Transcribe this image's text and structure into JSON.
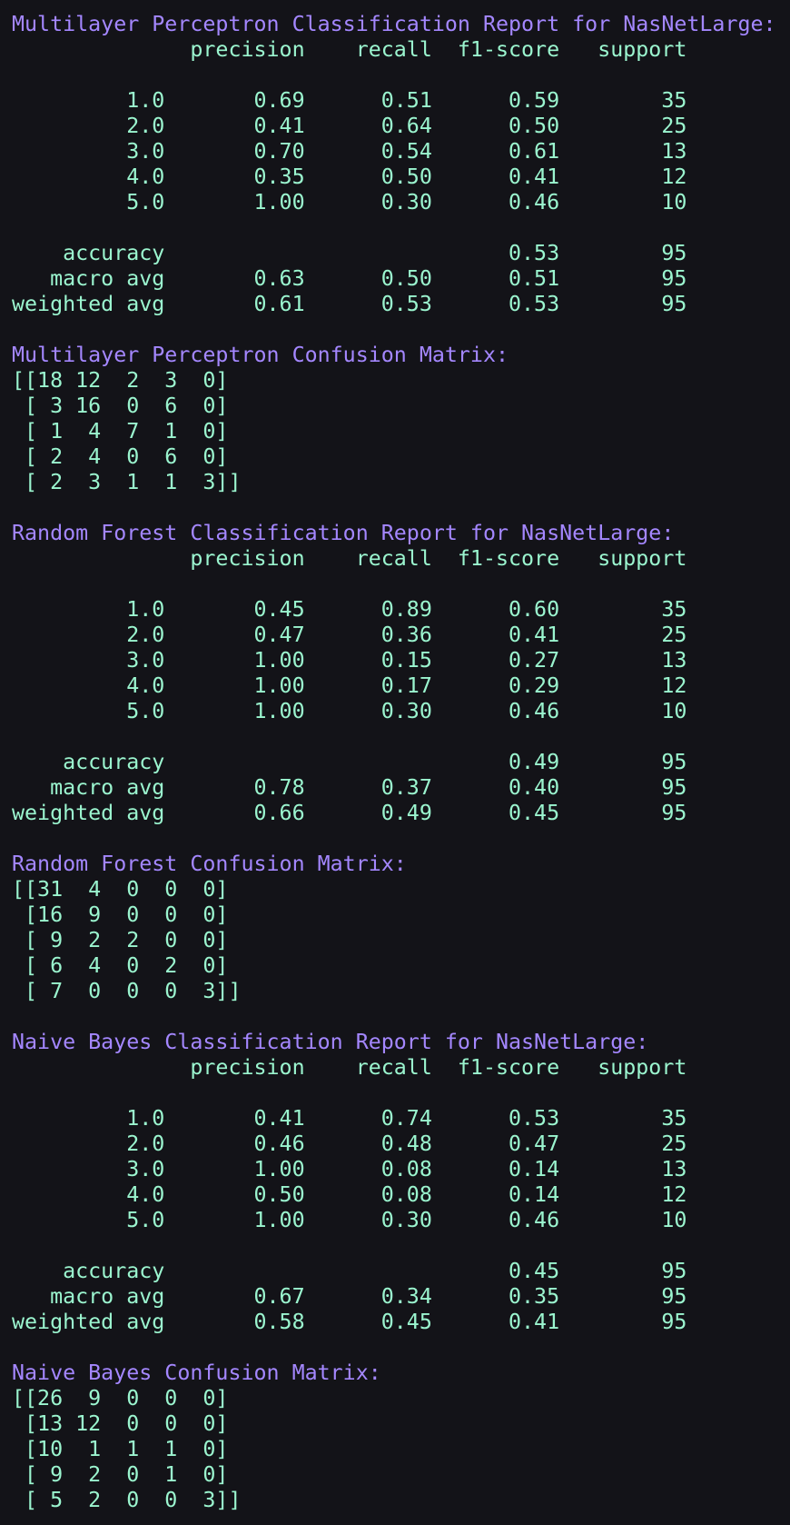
{
  "colors": {
    "background": "#131318",
    "heading": "#a487ff",
    "output": "#9bf5cf"
  },
  "lines": [
    {
      "t": "heading",
      "s": "Multilayer Perceptron Classification Report for NasNetLarge:"
    },
    {
      "t": "text",
      "s": "              precision    recall  f1-score   support"
    },
    {
      "t": "text",
      "s": ""
    },
    {
      "t": "text",
      "s": "         1.0       0.69      0.51      0.59        35"
    },
    {
      "t": "text",
      "s": "         2.0       0.41      0.64      0.50        25"
    },
    {
      "t": "text",
      "s": "         3.0       0.70      0.54      0.61        13"
    },
    {
      "t": "text",
      "s": "         4.0       0.35      0.50      0.41        12"
    },
    {
      "t": "text",
      "s": "         5.0       1.00      0.30      0.46        10"
    },
    {
      "t": "text",
      "s": ""
    },
    {
      "t": "text",
      "s": "    accuracy                           0.53        95"
    },
    {
      "t": "text",
      "s": "   macro avg       0.63      0.50      0.51        95"
    },
    {
      "t": "text",
      "s": "weighted avg       0.61      0.53      0.53        95"
    },
    {
      "t": "text",
      "s": ""
    },
    {
      "t": "heading",
      "s": "Multilayer Perceptron Confusion Matrix:"
    },
    {
      "t": "text",
      "s": "[[18 12  2  3  0]"
    },
    {
      "t": "text",
      "s": " [ 3 16  0  6  0]"
    },
    {
      "t": "text",
      "s": " [ 1  4  7  1  0]"
    },
    {
      "t": "text",
      "s": " [ 2  4  0  6  0]"
    },
    {
      "t": "text",
      "s": " [ 2  3  1  1  3]]"
    },
    {
      "t": "text",
      "s": ""
    },
    {
      "t": "heading",
      "s": "Random Forest Classification Report for NasNetLarge:"
    },
    {
      "t": "text",
      "s": "              precision    recall  f1-score   support"
    },
    {
      "t": "text",
      "s": ""
    },
    {
      "t": "text",
      "s": "         1.0       0.45      0.89      0.60        35"
    },
    {
      "t": "text",
      "s": "         2.0       0.47      0.36      0.41        25"
    },
    {
      "t": "text",
      "s": "         3.0       1.00      0.15      0.27        13"
    },
    {
      "t": "text",
      "s": "         4.0       1.00      0.17      0.29        12"
    },
    {
      "t": "text",
      "s": "         5.0       1.00      0.30      0.46        10"
    },
    {
      "t": "text",
      "s": ""
    },
    {
      "t": "text",
      "s": "    accuracy                           0.49        95"
    },
    {
      "t": "text",
      "s": "   macro avg       0.78      0.37      0.40        95"
    },
    {
      "t": "text",
      "s": "weighted avg       0.66      0.49      0.45        95"
    },
    {
      "t": "text",
      "s": ""
    },
    {
      "t": "heading",
      "s": "Random Forest Confusion Matrix:"
    },
    {
      "t": "text",
      "s": "[[31  4  0  0  0]"
    },
    {
      "t": "text",
      "s": " [16  9  0  0  0]"
    },
    {
      "t": "text",
      "s": " [ 9  2  2  0  0]"
    },
    {
      "t": "text",
      "s": " [ 6  4  0  2  0]"
    },
    {
      "t": "text",
      "s": " [ 7  0  0  0  3]]"
    },
    {
      "t": "text",
      "s": ""
    },
    {
      "t": "heading",
      "s": "Naive Bayes Classification Report for NasNetLarge:"
    },
    {
      "t": "text",
      "s": "              precision    recall  f1-score   support"
    },
    {
      "t": "text",
      "s": ""
    },
    {
      "t": "text",
      "s": "         1.0       0.41      0.74      0.53        35"
    },
    {
      "t": "text",
      "s": "         2.0       0.46      0.48      0.47        25"
    },
    {
      "t": "text",
      "s": "         3.0       1.00      0.08      0.14        13"
    },
    {
      "t": "text",
      "s": "         4.0       0.50      0.08      0.14        12"
    },
    {
      "t": "text",
      "s": "         5.0       1.00      0.30      0.46        10"
    },
    {
      "t": "text",
      "s": ""
    },
    {
      "t": "text",
      "s": "    accuracy                           0.45        95"
    },
    {
      "t": "text",
      "s": "   macro avg       0.67      0.34      0.35        95"
    },
    {
      "t": "text",
      "s": "weighted avg       0.58      0.45      0.41        95"
    },
    {
      "t": "text",
      "s": ""
    },
    {
      "t": "heading",
      "s": "Naive Bayes Confusion Matrix:"
    },
    {
      "t": "text",
      "s": "[[26  9  0  0  0]"
    },
    {
      "t": "text",
      "s": " [13 12  0  0  0]"
    },
    {
      "t": "text",
      "s": " [10  1  1  1  0]"
    },
    {
      "t": "text",
      "s": " [ 9  2  0  1  0]"
    },
    {
      "t": "text",
      "s": " [ 5  2  0  0  3]]"
    }
  ]
}
